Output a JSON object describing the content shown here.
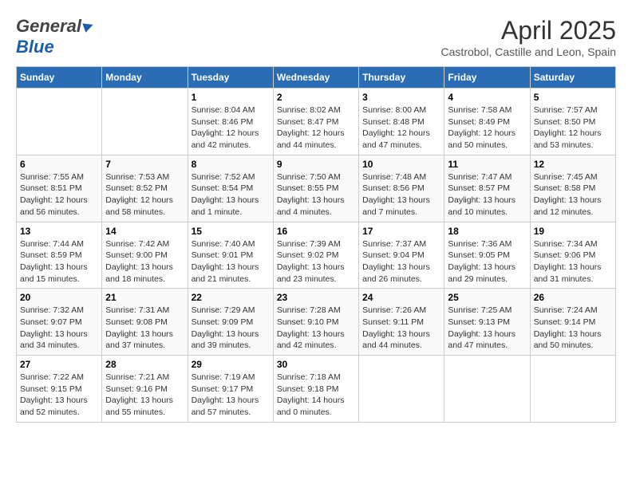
{
  "header": {
    "logo_general": "General",
    "logo_blue": "Blue",
    "month_title": "April 2025",
    "location": "Castrobol, Castille and Leon, Spain"
  },
  "calendar": {
    "days_of_week": [
      "Sunday",
      "Monday",
      "Tuesday",
      "Wednesday",
      "Thursday",
      "Friday",
      "Saturday"
    ],
    "weeks": [
      [
        {
          "day": "",
          "info": ""
        },
        {
          "day": "",
          "info": ""
        },
        {
          "day": "1",
          "info": "Sunrise: 8:04 AM\nSunset: 8:46 PM\nDaylight: 12 hours and 42 minutes."
        },
        {
          "day": "2",
          "info": "Sunrise: 8:02 AM\nSunset: 8:47 PM\nDaylight: 12 hours and 44 minutes."
        },
        {
          "day": "3",
          "info": "Sunrise: 8:00 AM\nSunset: 8:48 PM\nDaylight: 12 hours and 47 minutes."
        },
        {
          "day": "4",
          "info": "Sunrise: 7:58 AM\nSunset: 8:49 PM\nDaylight: 12 hours and 50 minutes."
        },
        {
          "day": "5",
          "info": "Sunrise: 7:57 AM\nSunset: 8:50 PM\nDaylight: 12 hours and 53 minutes."
        }
      ],
      [
        {
          "day": "6",
          "info": "Sunrise: 7:55 AM\nSunset: 8:51 PM\nDaylight: 12 hours and 56 minutes."
        },
        {
          "day": "7",
          "info": "Sunrise: 7:53 AM\nSunset: 8:52 PM\nDaylight: 12 hours and 58 minutes."
        },
        {
          "day": "8",
          "info": "Sunrise: 7:52 AM\nSunset: 8:54 PM\nDaylight: 13 hours and 1 minute."
        },
        {
          "day": "9",
          "info": "Sunrise: 7:50 AM\nSunset: 8:55 PM\nDaylight: 13 hours and 4 minutes."
        },
        {
          "day": "10",
          "info": "Sunrise: 7:48 AM\nSunset: 8:56 PM\nDaylight: 13 hours and 7 minutes."
        },
        {
          "day": "11",
          "info": "Sunrise: 7:47 AM\nSunset: 8:57 PM\nDaylight: 13 hours and 10 minutes."
        },
        {
          "day": "12",
          "info": "Sunrise: 7:45 AM\nSunset: 8:58 PM\nDaylight: 13 hours and 12 minutes."
        }
      ],
      [
        {
          "day": "13",
          "info": "Sunrise: 7:44 AM\nSunset: 8:59 PM\nDaylight: 13 hours and 15 minutes."
        },
        {
          "day": "14",
          "info": "Sunrise: 7:42 AM\nSunset: 9:00 PM\nDaylight: 13 hours and 18 minutes."
        },
        {
          "day": "15",
          "info": "Sunrise: 7:40 AM\nSunset: 9:01 PM\nDaylight: 13 hours and 21 minutes."
        },
        {
          "day": "16",
          "info": "Sunrise: 7:39 AM\nSunset: 9:02 PM\nDaylight: 13 hours and 23 minutes."
        },
        {
          "day": "17",
          "info": "Sunrise: 7:37 AM\nSunset: 9:04 PM\nDaylight: 13 hours and 26 minutes."
        },
        {
          "day": "18",
          "info": "Sunrise: 7:36 AM\nSunset: 9:05 PM\nDaylight: 13 hours and 29 minutes."
        },
        {
          "day": "19",
          "info": "Sunrise: 7:34 AM\nSunset: 9:06 PM\nDaylight: 13 hours and 31 minutes."
        }
      ],
      [
        {
          "day": "20",
          "info": "Sunrise: 7:32 AM\nSunset: 9:07 PM\nDaylight: 13 hours and 34 minutes."
        },
        {
          "day": "21",
          "info": "Sunrise: 7:31 AM\nSunset: 9:08 PM\nDaylight: 13 hours and 37 minutes."
        },
        {
          "day": "22",
          "info": "Sunrise: 7:29 AM\nSunset: 9:09 PM\nDaylight: 13 hours and 39 minutes."
        },
        {
          "day": "23",
          "info": "Sunrise: 7:28 AM\nSunset: 9:10 PM\nDaylight: 13 hours and 42 minutes."
        },
        {
          "day": "24",
          "info": "Sunrise: 7:26 AM\nSunset: 9:11 PM\nDaylight: 13 hours and 44 minutes."
        },
        {
          "day": "25",
          "info": "Sunrise: 7:25 AM\nSunset: 9:13 PM\nDaylight: 13 hours and 47 minutes."
        },
        {
          "day": "26",
          "info": "Sunrise: 7:24 AM\nSunset: 9:14 PM\nDaylight: 13 hours and 50 minutes."
        }
      ],
      [
        {
          "day": "27",
          "info": "Sunrise: 7:22 AM\nSunset: 9:15 PM\nDaylight: 13 hours and 52 minutes."
        },
        {
          "day": "28",
          "info": "Sunrise: 7:21 AM\nSunset: 9:16 PM\nDaylight: 13 hours and 55 minutes."
        },
        {
          "day": "29",
          "info": "Sunrise: 7:19 AM\nSunset: 9:17 PM\nDaylight: 13 hours and 57 minutes."
        },
        {
          "day": "30",
          "info": "Sunrise: 7:18 AM\nSunset: 9:18 PM\nDaylight: 14 hours and 0 minutes."
        },
        {
          "day": "",
          "info": ""
        },
        {
          "day": "",
          "info": ""
        },
        {
          "day": "",
          "info": ""
        }
      ]
    ]
  }
}
